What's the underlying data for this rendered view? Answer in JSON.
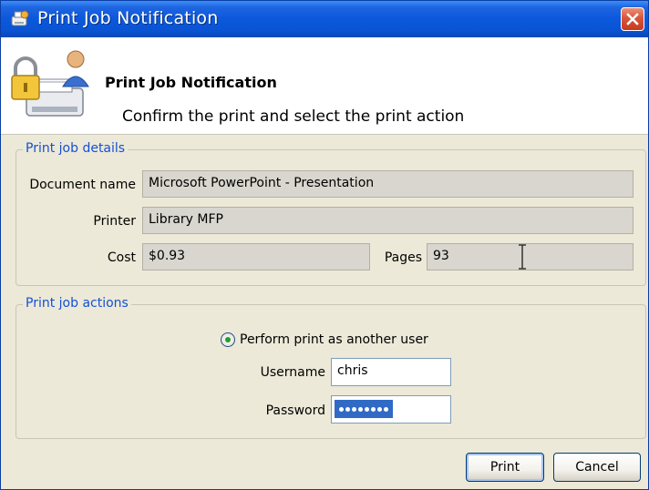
{
  "window": {
    "title": "Print Job Notification"
  },
  "banner": {
    "title": "Print Job Notification",
    "subtitle": "Confirm the print and select the print action"
  },
  "details": {
    "legend": "Print job details",
    "document_label": "Document name",
    "document_value": "Microsoft PowerPoint - Presentation",
    "printer_label": "Printer",
    "printer_value": "Library MFP",
    "cost_label": "Cost",
    "cost_value": "$0.93",
    "pages_label": "Pages",
    "pages_value": "93"
  },
  "actions": {
    "legend": "Print job actions",
    "radio_label": "Perform print as another user",
    "radio_selected": true,
    "username_label": "Username",
    "username_value": "chris",
    "password_label": "Password",
    "password_mask_count": 8
  },
  "buttons": {
    "print": "Print",
    "cancel": "Cancel"
  },
  "colors": {
    "titlebar": "#0a54d4",
    "legend_text": "#1550d6",
    "dialog_bg": "#ece9d8",
    "close_button": "#d8553b",
    "selection": "#316ac5"
  }
}
